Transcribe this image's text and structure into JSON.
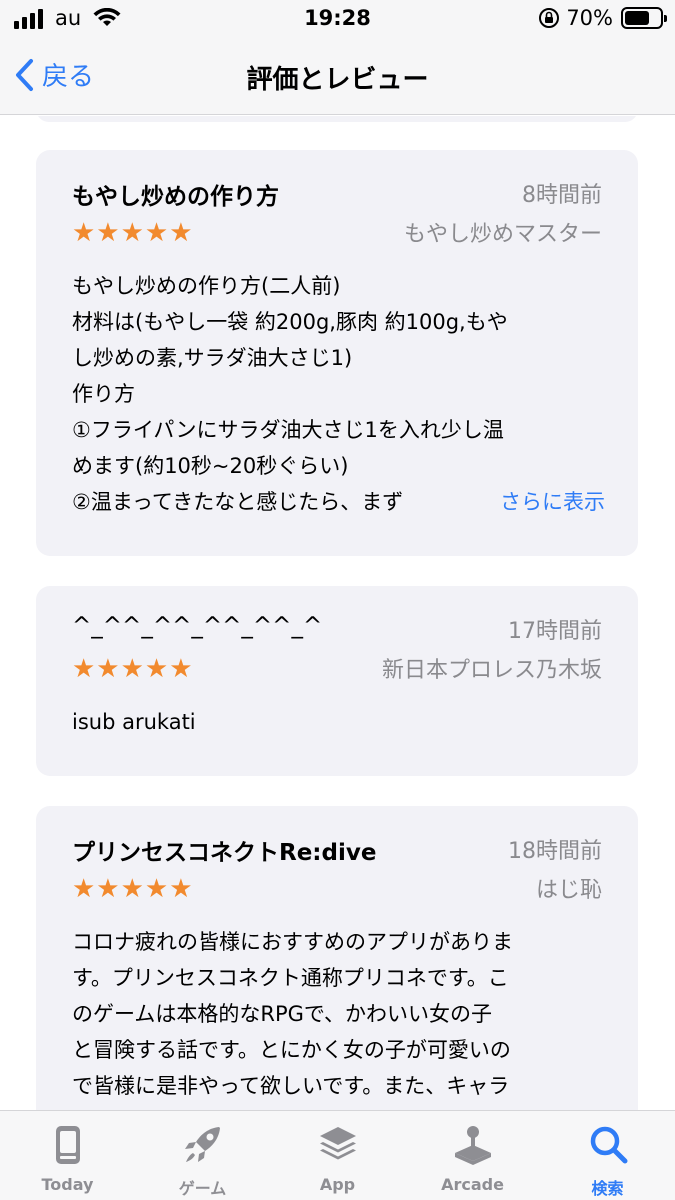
{
  "status_bar": {
    "carrier": "au",
    "time": "19:28",
    "battery_percent": "70%",
    "battery_level": 0.7
  },
  "nav": {
    "back_label": "戻る",
    "title": "評価とレビュー"
  },
  "reviews": [
    {
      "title": "もやし炒めの作り方",
      "date": "8時間前",
      "rating": 5,
      "author": "もやし炒めマスター",
      "body_lines": [
        "もやし炒めの作り方(二人前)",
        "材料は(もやし一袋 約200g,豚肉 約100g,もや",
        "し炒めの素,サラダ油大さじ1)",
        "作り方",
        "①フライパンにサラダ油大さじ1を入れ少し温",
        "めます(約10秒~20秒ぐらい)",
        "②温まってきたなと感じたら、まず"
      ],
      "more_label": "さらに表示"
    },
    {
      "title": "^_^^_^^_^^_^^_^",
      "date": "17時間前",
      "rating": 5,
      "author": "新日本プロレス乃木坂",
      "body_lines": [
        "isub arukati"
      ]
    },
    {
      "title": "プリンセスコネクトRe:dive",
      "date": "18時間前",
      "rating": 5,
      "author": "はじ恥",
      "body_lines": [
        "コロナ疲れの皆様におすすめのアプリがありま",
        "す。プリンセスコネクト通称プリコネです。こ",
        "のゲームは本格的なRPGで、かわいい女の子",
        "と冒険する話です。とにかく女の子が可愛いの",
        "で皆様に是非やって欲しいです。また、キャラ"
      ]
    }
  ],
  "tabs": [
    {
      "label": "Today",
      "icon": "today-icon",
      "active": false
    },
    {
      "label": "ゲーム",
      "icon": "rocket-icon",
      "active": false
    },
    {
      "label": "App",
      "icon": "app-stack-icon",
      "active": false
    },
    {
      "label": "Arcade",
      "icon": "joystick-icon",
      "active": false
    },
    {
      "label": "検索",
      "icon": "search-icon",
      "active": true
    }
  ],
  "colors": {
    "accent": "#2f7cf6",
    "star": "#f28a2e",
    "card_bg": "#f2f2f7",
    "secondary_text": "#8a8a8e",
    "tab_inactive": "#8e8e93"
  }
}
